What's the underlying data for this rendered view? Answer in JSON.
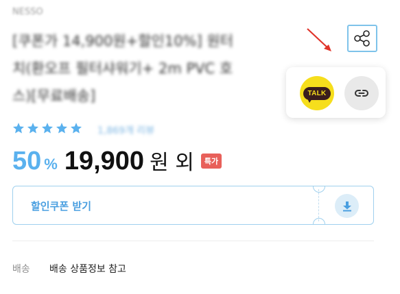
{
  "product": {
    "brand": "NESSO",
    "title_lines": [
      "[쿠폰가 14,900원+할인10%] 원터",
      "치(환오프 필터샤워기+ 2m PVC 호",
      "스)[무료배송]"
    ]
  },
  "rating": {
    "stars": 5,
    "review_count": "1,869개 리뷰"
  },
  "price": {
    "discount_percent": "50",
    "percent_symbol": "%",
    "amount": "19,900",
    "suffix": "원 외",
    "badge": "특가"
  },
  "share": {
    "button_icon": "share-icon",
    "kakao_label": "TALK",
    "kakao_icon": "kakaotalk-icon",
    "link_icon": "link-icon"
  },
  "coupon": {
    "label": "할인쿠폰 받기",
    "icon": "download-icon"
  },
  "shipping": {
    "label": "배송",
    "value": "배송 상품정보 참고"
  },
  "colors": {
    "accent_blue": "#5ab1ee",
    "star": "#5ab1ee",
    "badge_red": "#e8605a",
    "kakao_yellow": "#f6de1c",
    "annotation_arrow": "#e0342a"
  }
}
